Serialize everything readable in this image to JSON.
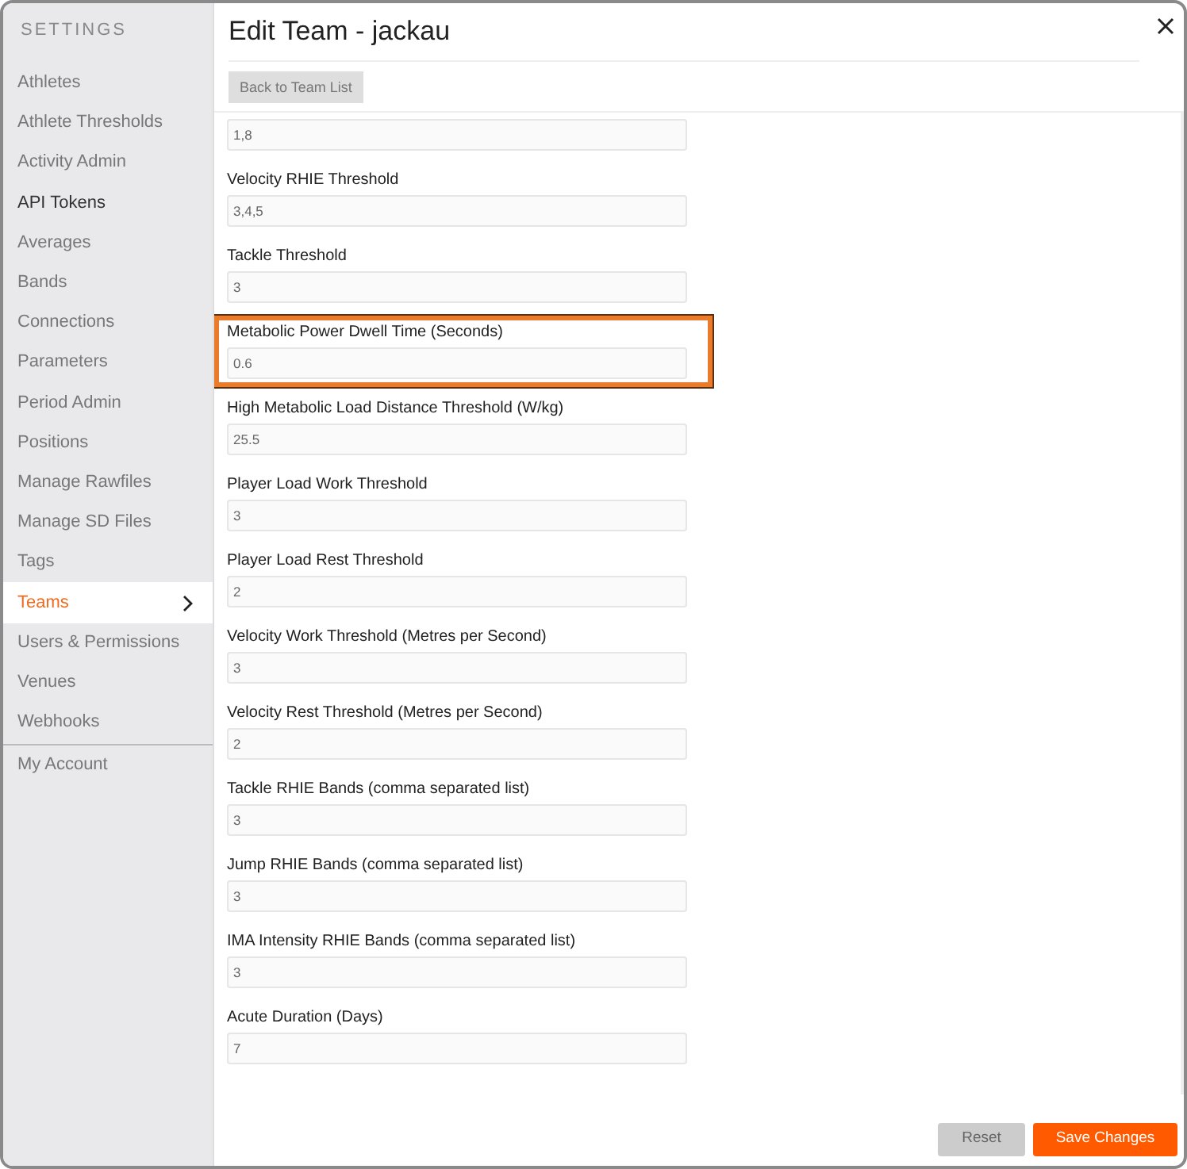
{
  "sidebar": {
    "heading": "SETTINGS",
    "items": [
      {
        "label": "Athletes",
        "selected": false,
        "emphasized": false,
        "divider_before": false
      },
      {
        "label": "Athlete Thresholds",
        "selected": false,
        "emphasized": false,
        "divider_before": false
      },
      {
        "label": "Activity Admin",
        "selected": false,
        "emphasized": false,
        "divider_before": false
      },
      {
        "label": "API Tokens",
        "selected": false,
        "emphasized": true,
        "divider_before": false
      },
      {
        "label": "Averages",
        "selected": false,
        "emphasized": false,
        "divider_before": false
      },
      {
        "label": "Bands",
        "selected": false,
        "emphasized": false,
        "divider_before": false
      },
      {
        "label": "Connections",
        "selected": false,
        "emphasized": false,
        "divider_before": false
      },
      {
        "label": "Parameters",
        "selected": false,
        "emphasized": false,
        "divider_before": false
      },
      {
        "label": "Period Admin",
        "selected": false,
        "emphasized": false,
        "divider_before": false
      },
      {
        "label": "Positions",
        "selected": false,
        "emphasized": false,
        "divider_before": false
      },
      {
        "label": "Manage Rawfiles",
        "selected": false,
        "emphasized": false,
        "divider_before": false
      },
      {
        "label": "Manage SD Files",
        "selected": false,
        "emphasized": false,
        "divider_before": false
      },
      {
        "label": "Tags",
        "selected": false,
        "emphasized": false,
        "divider_before": false
      },
      {
        "label": "Teams",
        "selected": true,
        "emphasized": false,
        "divider_before": false
      },
      {
        "label": "Users & Permissions",
        "selected": false,
        "emphasized": false,
        "divider_before": false
      },
      {
        "label": "Venues",
        "selected": false,
        "emphasized": false,
        "divider_before": false
      },
      {
        "label": "Webhooks",
        "selected": false,
        "emphasized": false,
        "divider_before": false
      },
      {
        "label": "My Account",
        "selected": false,
        "emphasized": false,
        "divider_before": true
      }
    ]
  },
  "dialog": {
    "title": "Edit Team - jackau",
    "back_button": "Back to Team List",
    "fields": [
      {
        "value": "1,8",
        "highlighted": false
      },
      {
        "label": "Velocity RHIE Threshold",
        "value": "3,4,5",
        "highlighted": false
      },
      {
        "label": "Tackle Threshold",
        "value": "3",
        "highlighted": false
      },
      {
        "label": "Metabolic Power Dwell Time (Seconds)",
        "value": "0.6",
        "highlighted": true
      },
      {
        "label": "High Metabolic Load Distance Threshold (W/kg)",
        "value": "25.5",
        "highlighted": false
      },
      {
        "label": "Player Load Work Threshold",
        "value": "3",
        "highlighted": false
      },
      {
        "label": "Player Load Rest Threshold",
        "value": "2",
        "highlighted": false
      },
      {
        "label": "Velocity Work Threshold (Metres per Second)",
        "value": "3",
        "highlighted": false
      },
      {
        "label": "Velocity Rest Threshold (Metres per Second)",
        "value": "2",
        "highlighted": false
      },
      {
        "label": "Tackle RHIE Bands (comma separated list)",
        "value": "3",
        "highlighted": false
      },
      {
        "label": "Jump RHIE Bands (comma separated list)",
        "value": "3",
        "highlighted": false
      },
      {
        "label": "IMA Intensity RHIE Bands (comma separated list)",
        "value": "3",
        "highlighted": false
      },
      {
        "label": "Acute Duration (Days)",
        "value": "7",
        "highlighted": false
      }
    ],
    "buttons": [
      {
        "label": "Reset",
        "kind": "secondary"
      },
      {
        "label": "Save Changes",
        "kind": "primary"
      }
    ]
  }
}
